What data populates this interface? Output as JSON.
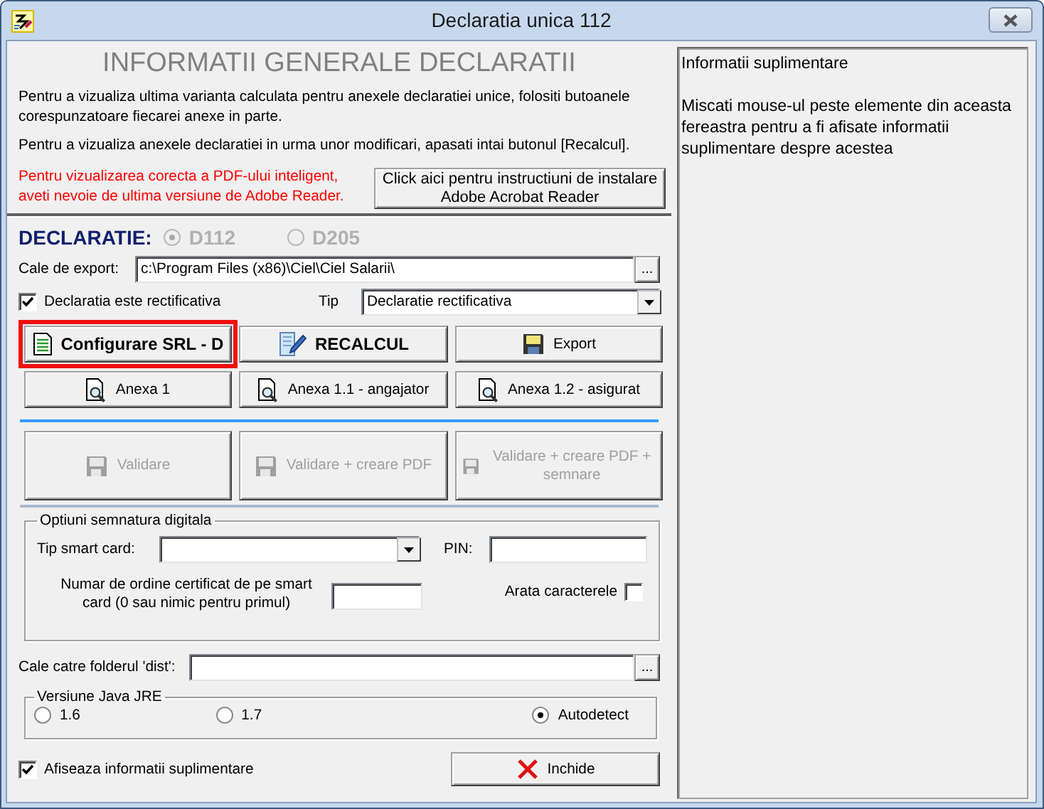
{
  "window": {
    "title": "Declaratia unica 112"
  },
  "header": {
    "title": "INFORMATII GENERALE DECLARATII",
    "paragraphs": [
      "Pentru a vizualiza ultima varianta calculata pentru anexele declaratiei unice, folositi butoanele corespunzatoare fiecarei anexe in parte.",
      "Pentru a vizualiza anexele declaratiei in urma unor modificari, apasati intai butonul [Recalcul]."
    ],
    "warning": "Pentru vizualizarea corecta a PDF-ului inteligent, aveti nevoie de ultima versiune de Adobe Reader.",
    "install_button": "Click aici pentru instructiuni de instalare Adobe Acrobat Reader"
  },
  "declaration": {
    "label": "DECLARATIE:",
    "options": [
      {
        "label": "D112",
        "selected": true,
        "disabled": true
      },
      {
        "label": "D205",
        "selected": false,
        "disabled": true
      }
    ]
  },
  "export_path": {
    "label": "Cale de export:",
    "value": "c:\\Program Files (x86)\\Ciel\\Ciel Salarii\\",
    "browse": "..."
  },
  "rectificativa": {
    "label": "Declaratia este rectificativa",
    "checked": true
  },
  "tip": {
    "label": "Tip",
    "value": "Declaratie rectificativa"
  },
  "action_buttons": [
    {
      "label": "Configurare SRL - D",
      "bold": true,
      "highlighted": true
    },
    {
      "label": "RECALCUL",
      "bold": true,
      "highlighted": false
    },
    {
      "label": "Export",
      "bold": false,
      "highlighted": false
    }
  ],
  "annex_buttons": [
    {
      "label": "Anexa 1"
    },
    {
      "label": "Anexa 1.1 - angajator"
    },
    {
      "label": "Anexa 1.2 - asigurat"
    }
  ],
  "validation_buttons": [
    {
      "label": "Validare",
      "disabled": true
    },
    {
      "label": "Validare + creare PDF",
      "disabled": true
    },
    {
      "label": "Validare + creare PDF + semnare",
      "disabled": true
    }
  ],
  "signature": {
    "title": "Optiuni semnatura digitala",
    "card_type": {
      "label": "Tip smart card:"
    },
    "pin": {
      "label": "PIN:"
    },
    "certificate": {
      "label": "Numar de ordine certificat de pe smart card (0 sau nimic pentru primul)"
    },
    "show_chars": {
      "label": "Arata caracterele",
      "checked": false
    }
  },
  "dist_path": {
    "label": "Cale catre folderul 'dist':",
    "browse": "..."
  },
  "java": {
    "title": "Versiune Java JRE",
    "options": [
      {
        "label": "1.6",
        "selected": false
      },
      {
        "label": "1.7",
        "selected": false
      },
      {
        "label": "Autodetect",
        "selected": true
      }
    ]
  },
  "show_info": {
    "label": "Afiseaza informatii suplimentare",
    "checked": true
  },
  "close_button": {
    "label": "Inchide"
  },
  "info_panel": {
    "title": "Informatii suplimentare",
    "text": "Miscati mouse-ul peste elemente din aceasta fereastra pentru a fi afisate informatii suplimentare despre acestea"
  }
}
